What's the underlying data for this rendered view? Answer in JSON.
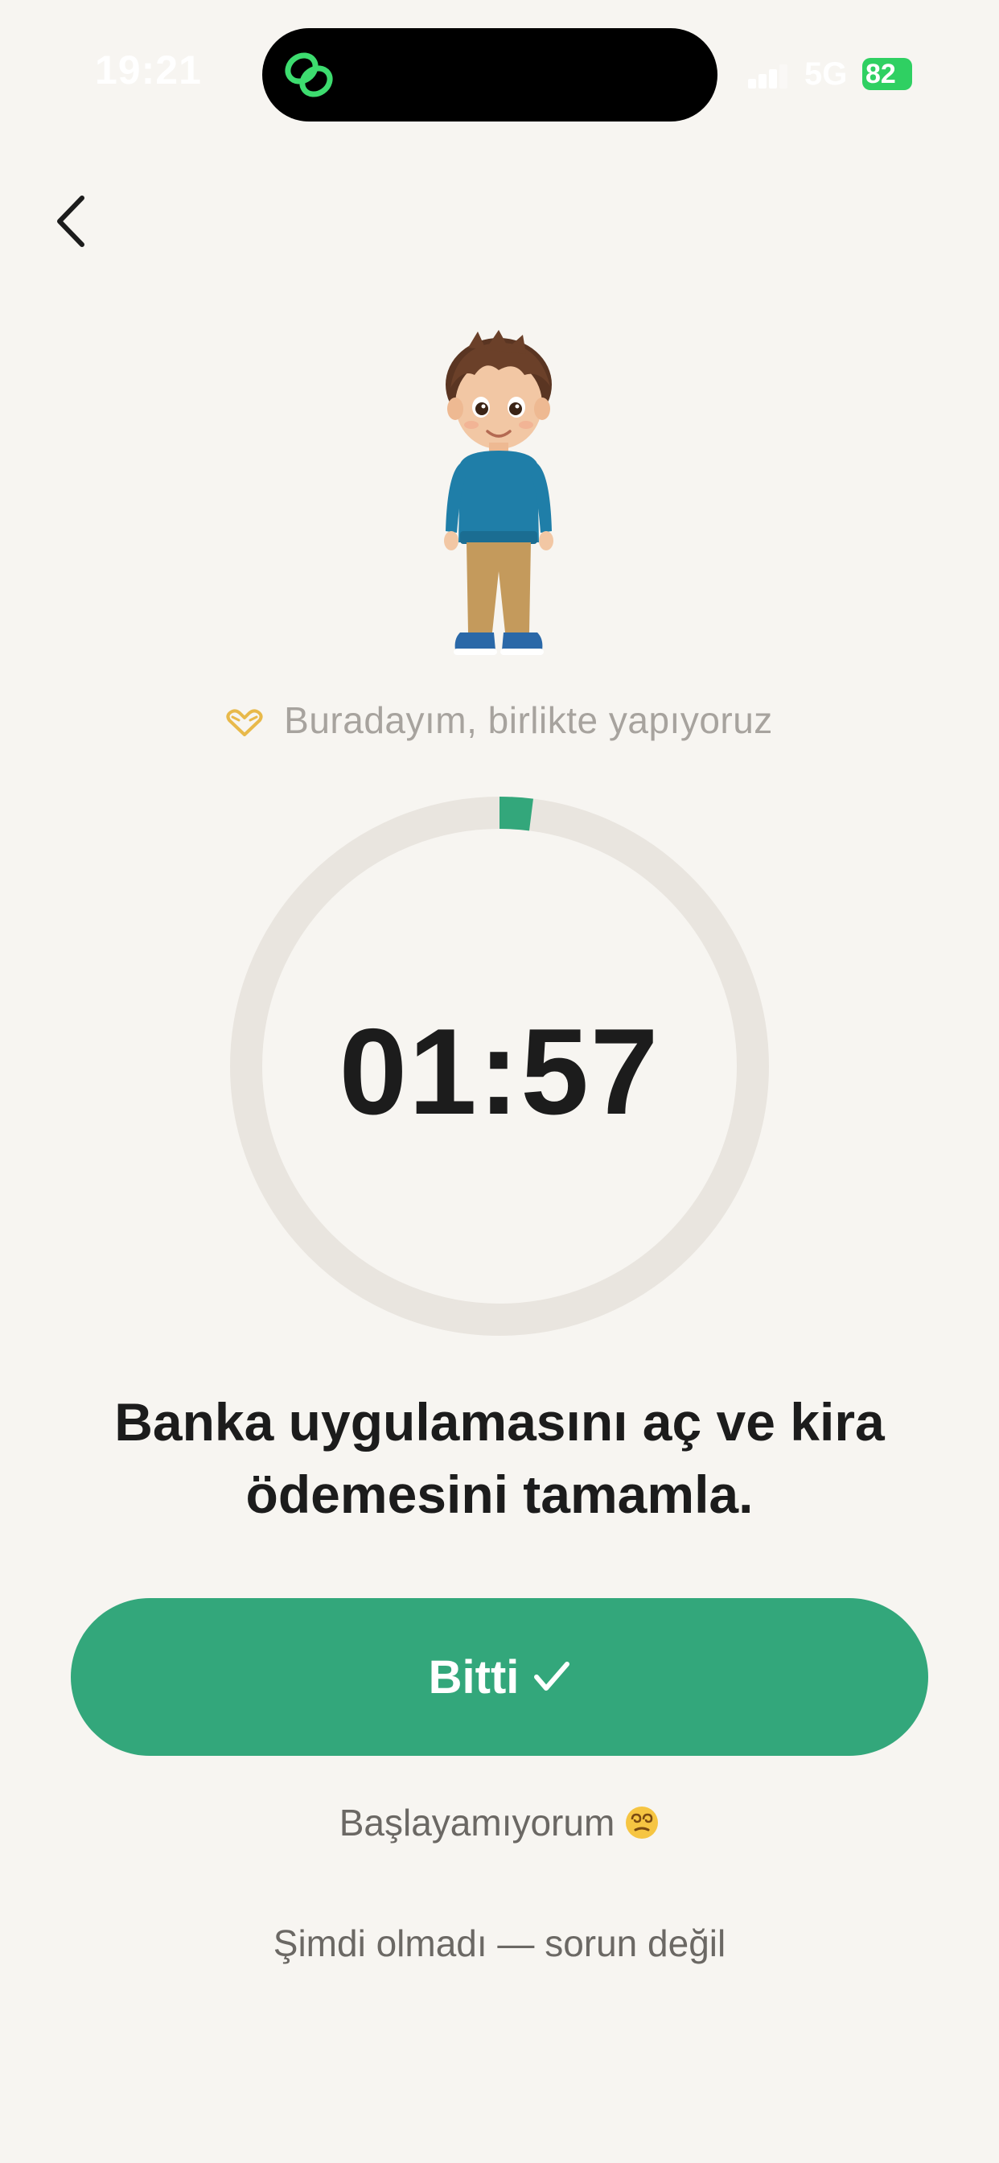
{
  "status_bar": {
    "time": "19:21",
    "network": "5G",
    "battery": "82"
  },
  "companion": {
    "message": "Buradayım, birlikte yapıyoruz",
    "message_icon": "heart-hands-icon",
    "avatar": "boy-avatar-illustration"
  },
  "timer": {
    "display": "01:57",
    "progress_fraction": 0.02
  },
  "task": {
    "text": "Banka uygulamasını aç ve kira ödemesini tamamla."
  },
  "actions": {
    "done_label": "Bitti",
    "cant_start_label": "Başlayamıyorum",
    "not_now_label": "Şimdi olmadı — sorun değil"
  },
  "colors": {
    "background": "#f7f5f1",
    "accent": "#33a77b",
    "ring_track": "#e9e5df",
    "battery": "#2fd062"
  }
}
